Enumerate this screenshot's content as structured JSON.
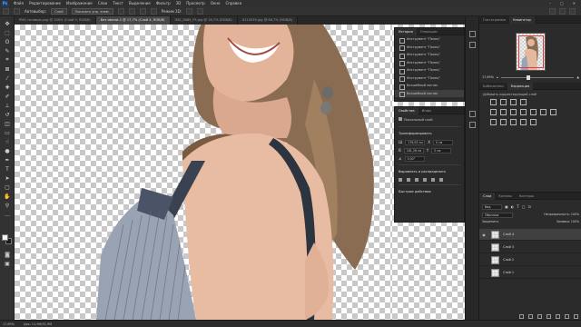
{
  "app": {
    "logo": "Ps"
  },
  "menu": [
    "Файл",
    "Редактирование",
    "Изображение",
    "Слои",
    "Текст",
    "Выделение",
    "Фильтр",
    "3D",
    "Просмотр",
    "Окно",
    "Справка"
  ],
  "options": {
    "auto_select": "Автовыбор:",
    "layer": "Слой",
    "show_controls": "Показать упр. элем.",
    "mode_3d": "Режим 3D:"
  },
  "tabs": [
    {
      "label": "PNG готовые.png @ 100% (Слой 0, RGB/8)",
      "active": false
    },
    {
      "label": "Без имени-1 @ 17,7% (Слой 4, RGB/8)",
      "active": true
    },
    {
      "label": "IMG_0885_PS.jpg @ 16,7% (RGB/8)",
      "active": false
    },
    {
      "label": "4115935.jpg @ 66,7% (RGB/8)",
      "active": false
    }
  ],
  "history": {
    "tabs": [
      "История",
      "Операции"
    ],
    "items": [
      "Инструмент \"Палец\"",
      "Инструмент \"Палец\"",
      "Инструмент \"Палец\"",
      "Инструмент \"Палец\"",
      "Инструмент \"Палец\"",
      "Инструмент \"Палец\"",
      "Волшебный ластик",
      "Волшебный ластик"
    ]
  },
  "properties": {
    "tabs": [
      "Свойства",
      "Инфо"
    ],
    "kind": "Пиксельный слой",
    "transform_header": "Трансформировать",
    "w": "176,03 см",
    "h": "181,28 см",
    "x": "0 см",
    "y": "0 см",
    "angle": "0,00°",
    "align_header": "Выровнять и распределить",
    "quick_actions": "Быстрые действия"
  },
  "navigator": {
    "tabs": [
      "Гистограмма",
      "Навигатор"
    ],
    "zoom": "17,69%",
    "zoom_fraction": 0.35
  },
  "library": {
    "tabs": [
      "Библиотеки",
      "Коррекция"
    ],
    "add_label": "Добавить корректирующий слой"
  },
  "layers": {
    "tabs": [
      "Слои",
      "Каналы",
      "Контуры"
    ],
    "filter": "Вид",
    "blend": "Обычные",
    "opacity_label": "Непрозрачность:",
    "opacity": "100%",
    "lock_label": "Закрепить:",
    "fill_label": "Заливка:",
    "fill": "100%",
    "items": [
      {
        "name": "Слой 4",
        "selected": true
      },
      {
        "name": "Слой 3",
        "selected": false
      },
      {
        "name": "Слой 2",
        "selected": false
      },
      {
        "name": "Слой 1",
        "selected": false
      }
    ]
  },
  "status": {
    "zoom": "17,69%",
    "doc": "Док: 11,9М/31,9М"
  }
}
